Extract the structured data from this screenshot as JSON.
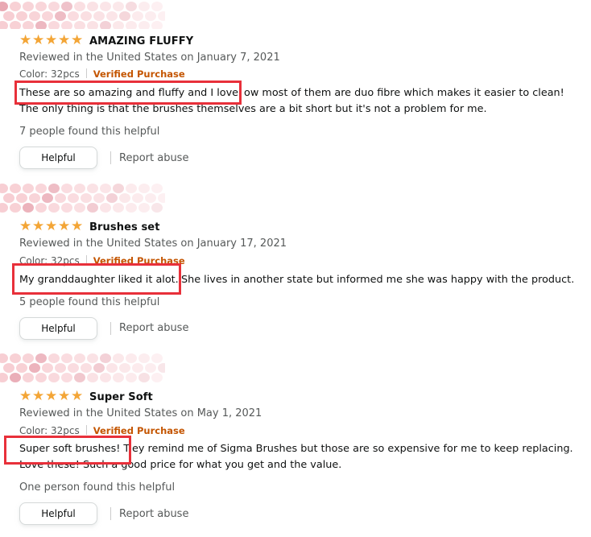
{
  "reviews": [
    {
      "title": "AMAZING FLUFFY",
      "stars": 5,
      "reviewed": "Reviewed in the United States on January 7, 2021",
      "color": "Color: 32pcs",
      "verified": "Verified Purchase",
      "highlight": "These are so amazing and fluffy and I love",
      "line1_rest": "ow most of them are duo fibre which makes it easier to clean!",
      "line2": "The only thing is that the brushes themselves are a bit short but it's not a problem for me.",
      "helpful_count": "7 people found this helpful",
      "helpful_button": "Helpful",
      "report": "Report abuse"
    },
    {
      "title": "Brushes set",
      "stars": 5,
      "reviewed": "Reviewed in the United States on January 17, 2021",
      "color": "Color: 32pcs",
      "verified": "Verified Purchase",
      "highlight": "My granddaughter liked it alot.",
      "line1_rest": "She lives in another state but informed me she was happy with the product.",
      "line2": "",
      "helpful_count": "5 people found this helpful",
      "helpful_button": "Helpful",
      "report": "Report abuse"
    },
    {
      "title": "Super Soft",
      "stars": 5,
      "reviewed": "Reviewed in the United States on May 1, 2021",
      "color": "Color: 32pcs",
      "verified": "Verified Purchase",
      "highlight": "Super soft brushes! T",
      "line1_rest": "ey remind me of Sigma Brushes but those are so expensive for me to keep replacing.",
      "line2": "Love these! Such a good price for what you get and the value.",
      "helpful_count": "One person found this helpful",
      "helpful_button": "Helpful",
      "report": "Report abuse"
    }
  ],
  "colors": {
    "star": "#f3a536",
    "verified": "#c45500",
    "highlight_box": "#e8303a",
    "avatar_hearts": "#f6c5cb"
  },
  "icons": {
    "star": "star-icon",
    "avatar": "hearts-avatar-icon"
  }
}
